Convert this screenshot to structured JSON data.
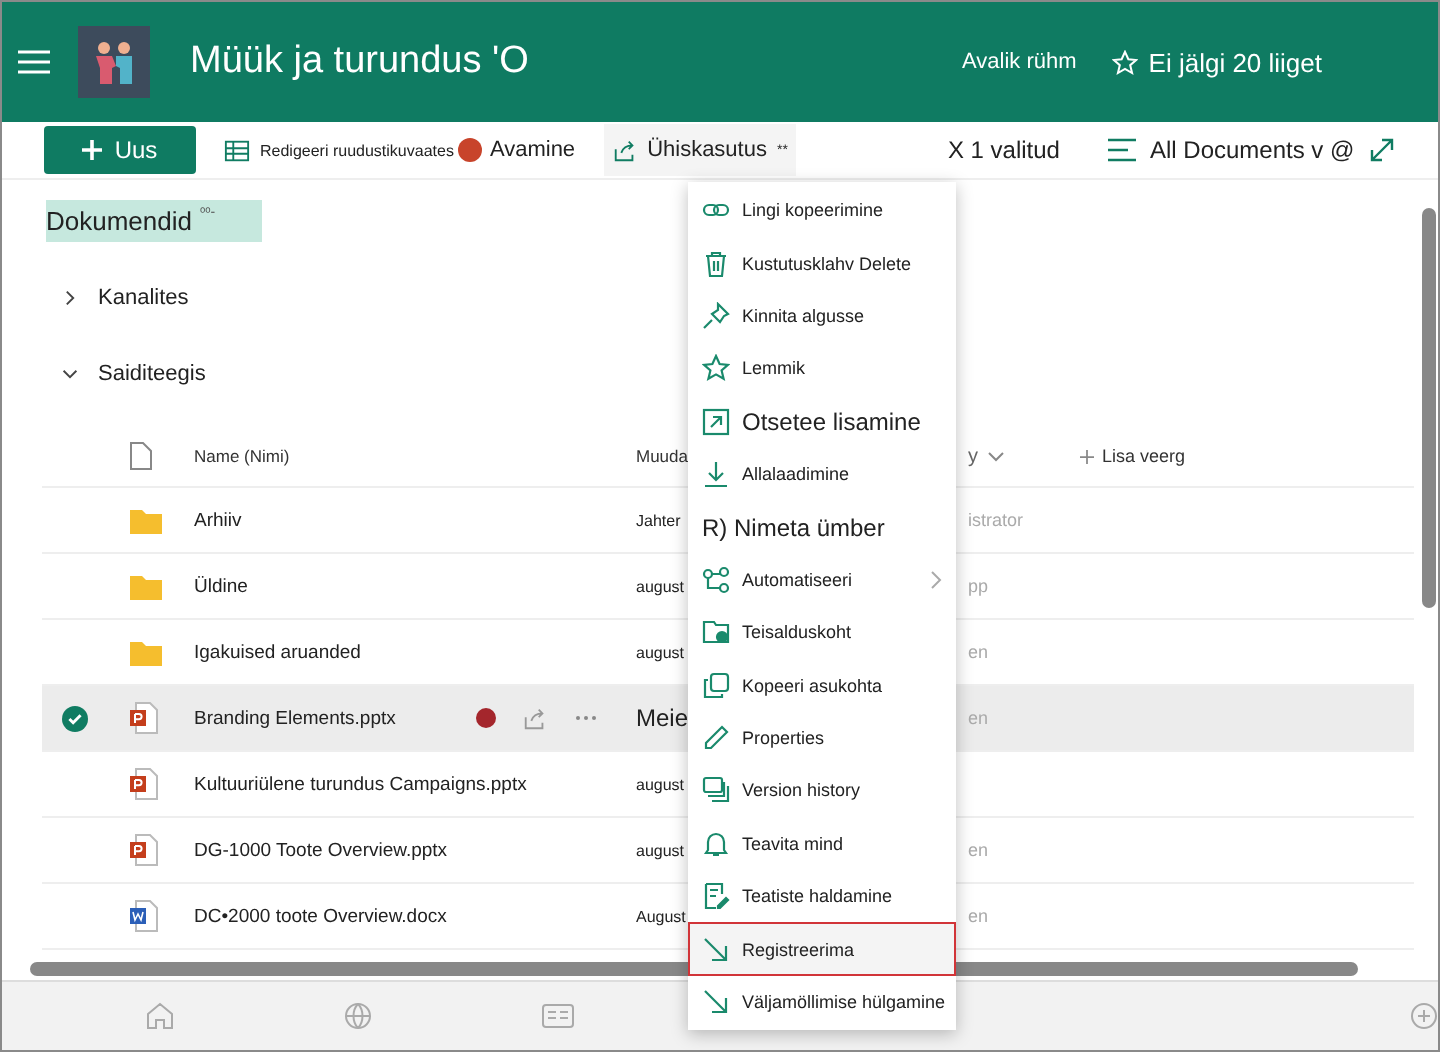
{
  "header": {
    "title": "Müük ja turundus 'O",
    "privacy": "Avalik rühm",
    "follow": "Ei jälgi 20 liiget"
  },
  "toolbar": {
    "new": "Uus",
    "edit_grid": "Redigeeri ruudustikuvaates",
    "open": "Avamine",
    "share": "Ühiskasutus",
    "share_more": "**",
    "selected_count": "X 1 valitud",
    "view": "All Documents v @"
  },
  "library": {
    "title": "Dokumendid",
    "tag": "ᵒᵒ-"
  },
  "sections": [
    {
      "label": "Kanalites",
      "expanded": false
    },
    {
      "label": "Saiditeegis",
      "expanded": true
    }
  ],
  "table": {
    "columns": [
      "Name (Nimi)",
      "Muuda",
      "y",
      "Lisa veerg"
    ],
    "rows": [
      {
        "kind": "folder",
        "name": "Arhiiv",
        "modified": "Jahter",
        "modified_by": "istrator",
        "selected": false
      },
      {
        "kind": "folder",
        "name": "Üldine",
        "modified": "august",
        "modified_by": "pp",
        "selected": false
      },
      {
        "kind": "folder",
        "name": "Igakuised aruanded",
        "modified": "august",
        "modified_by": "en",
        "selected": false
      },
      {
        "kind": "pptx",
        "name": "Branding Elements.pptx",
        "modified": "Meie",
        "modified_by": "en",
        "selected": true
      },
      {
        "kind": "pptx",
        "name": "Kultuuriülene turundus Campaigns.pptx",
        "modified": "august",
        "modified_by": "",
        "selected": false
      },
      {
        "kind": "pptx",
        "name": "DG-1000 Toote Overview.pptx",
        "modified": "august",
        "modified_by": "en",
        "selected": false
      },
      {
        "kind": "docx",
        "name": "DC•2000 toote Overview.docx",
        "modified": "August",
        "modified_by": "en",
        "selected": false
      }
    ]
  },
  "menu": [
    {
      "kind": "link",
      "label": "Lingi kopeerimine"
    },
    {
      "kind": "trash",
      "label": "Kustutusklahv Delete"
    },
    {
      "kind": "pin",
      "label": "Kinnita algusse"
    },
    {
      "kind": "star",
      "label": "Lemmik"
    },
    {
      "kind": "shortcut",
      "label": "Otsetee lisamine",
      "large": true
    },
    {
      "kind": "download",
      "label": "Allalaadimine"
    },
    {
      "kind": "plain",
      "label": "R) Nimeta ümber",
      "large": true
    },
    {
      "kind": "automate",
      "label": "Automatiseeri",
      "submenu": true
    },
    {
      "kind": "move",
      "label": "Teisalduskoht"
    },
    {
      "kind": "copy",
      "label": "Kopeeri asukohta"
    },
    {
      "kind": "pencil",
      "label": "Properties"
    },
    {
      "kind": "versions",
      "label": "Version history"
    },
    {
      "kind": "bell",
      "label": "Teavita mind"
    },
    {
      "kind": "alerts",
      "label": "Teatiste haldamine"
    },
    {
      "kind": "checkin",
      "label": "Registreerima",
      "highlighted": true
    },
    {
      "kind": "checkin",
      "label": "Väljamöllimise hülgamine"
    }
  ]
}
